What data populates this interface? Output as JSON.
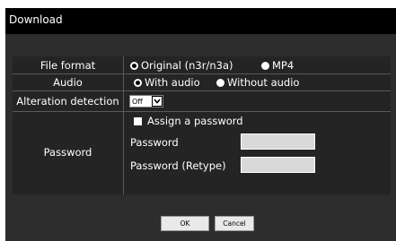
{
  "window": {
    "title": "Download"
  },
  "form": {
    "file_format": {
      "label": "File format",
      "options": [
        {
          "label": "Original (n3r/n3a)",
          "selected": true
        },
        {
          "label": "MP4",
          "selected": false
        }
      ]
    },
    "audio": {
      "label": "Audio",
      "options": [
        {
          "label": "With audio",
          "selected": true
        },
        {
          "label": "Without audio",
          "selected": false
        }
      ]
    },
    "alteration_detection": {
      "label": "Alteration detection",
      "value": "Off"
    },
    "password": {
      "label": "Password",
      "assign_label": "Assign a password",
      "assign_checked": false,
      "password_label": "Password",
      "password_value": "",
      "retype_label": "Password (Retype)",
      "retype_value": ""
    }
  },
  "buttons": {
    "ok": "OK",
    "cancel": "Cancel"
  }
}
